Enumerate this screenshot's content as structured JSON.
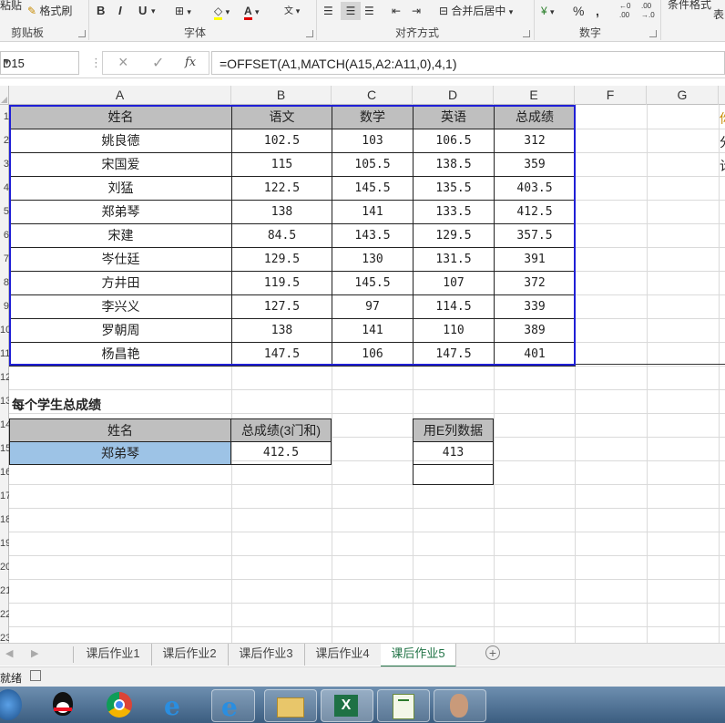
{
  "ribbon": {
    "clipboard_partial": "粘贴",
    "format_painter": "格式刷",
    "bold": "B",
    "italic": "I",
    "underline": "U",
    "merge_center": "合并后居中",
    "percent": "%",
    "comma": ",",
    "conditional_format": "条件格式",
    "table_partial": "表",
    "groups": {
      "clipboard": "剪贴板",
      "font": "字体",
      "alignment": "对齐方式",
      "number": "数字"
    }
  },
  "formula_bar": {
    "name_box": "D15",
    "cancel": "×",
    "enter": "✓",
    "fx": "fx",
    "formula": "=OFFSET(A1,MATCH(A15,A2:A11,0),4,1)"
  },
  "columns": [
    "A",
    "B",
    "C",
    "D",
    "E",
    "F",
    "G"
  ],
  "row_numbers": [
    "1",
    "2",
    "3",
    "4",
    "5",
    "6",
    "7",
    "8",
    "9",
    "10",
    "11",
    "12",
    "13",
    "14",
    "15",
    "16",
    "17",
    "18",
    "19",
    "20",
    "21",
    "22",
    "23",
    "24"
  ],
  "table": {
    "headers": [
      "姓名",
      "语文",
      "数学",
      "英语",
      "总成绩"
    ],
    "rows": [
      [
        "姚良德",
        "102.5",
        "103",
        "106.5",
        "312"
      ],
      [
        "宋国爱",
        "115",
        "105.5",
        "138.5",
        "359"
      ],
      [
        "刘猛",
        "122.5",
        "145.5",
        "135.5",
        "403.5"
      ],
      [
        "郑弟琴",
        "138",
        "141",
        "133.5",
        "412.5"
      ],
      [
        "宋建",
        "84.5",
        "143.5",
        "129.5",
        "357.5"
      ],
      [
        "岑仕廷",
        "129.5",
        "130",
        "131.5",
        "391"
      ],
      [
        "方井田",
        "119.5",
        "145.5",
        "107",
        "372"
      ],
      [
        "李兴义",
        "127.5",
        "97",
        "114.5",
        "339"
      ],
      [
        "罗朝周",
        "138",
        "141",
        "110",
        "389"
      ],
      [
        "杨昌艳",
        "147.5",
        "106",
        "147.5",
        "401"
      ]
    ]
  },
  "side_partial": [
    "你",
    "分",
    "计"
  ],
  "summary": {
    "title": "每个学生总成绩",
    "name_header": "姓名",
    "total_header": "总成绩(3门和)",
    "name_value": "郑弟琴",
    "total_value": "412.5",
    "alt_header": "用E列数据",
    "alt_value": "413"
  },
  "sheet_tabs": [
    "课后作业1",
    "课后作业2",
    "课后作业3",
    "课后作业4",
    "课后作业5"
  ],
  "active_tab": "课后作业5",
  "status_text": "就绪",
  "colors": {
    "header_gray": "#bfbfbf",
    "selected_blue": "#9dc3e6",
    "selection_border": "#1f1fd6",
    "excel_green": "#217346"
  }
}
